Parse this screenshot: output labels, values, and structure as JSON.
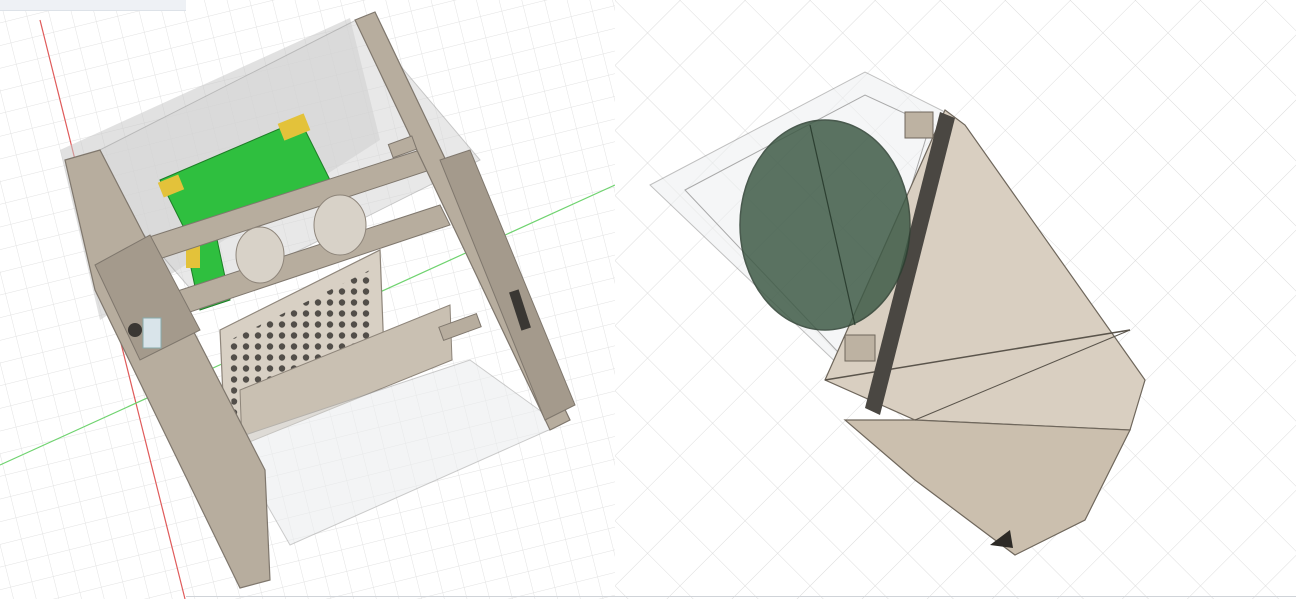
{
  "screen": {
    "panels": [
      {
        "id": "left",
        "description": ""
      },
      {
        "id": "right",
        "description": ""
      }
    ]
  },
  "colors": {
    "background": "#ffffff",
    "grid_minor": "#e4e4e4",
    "grid_major": "#d2d2d2",
    "axis_red": "#e05a5a",
    "axis_green": "#6fd36f",
    "frame_tan": "#b7ad9e",
    "frame_dark": "#8e857a",
    "panel_light": "#d8d0c4",
    "pcb_green": "#2fbf3f",
    "connector_yellow": "#e3c23a",
    "lens_green": "#3f5b47",
    "glass": "#dfe3e6"
  },
  "icons": [
    "grid-canvas",
    "cube-frame-model",
    "optic-housing-model"
  ]
}
